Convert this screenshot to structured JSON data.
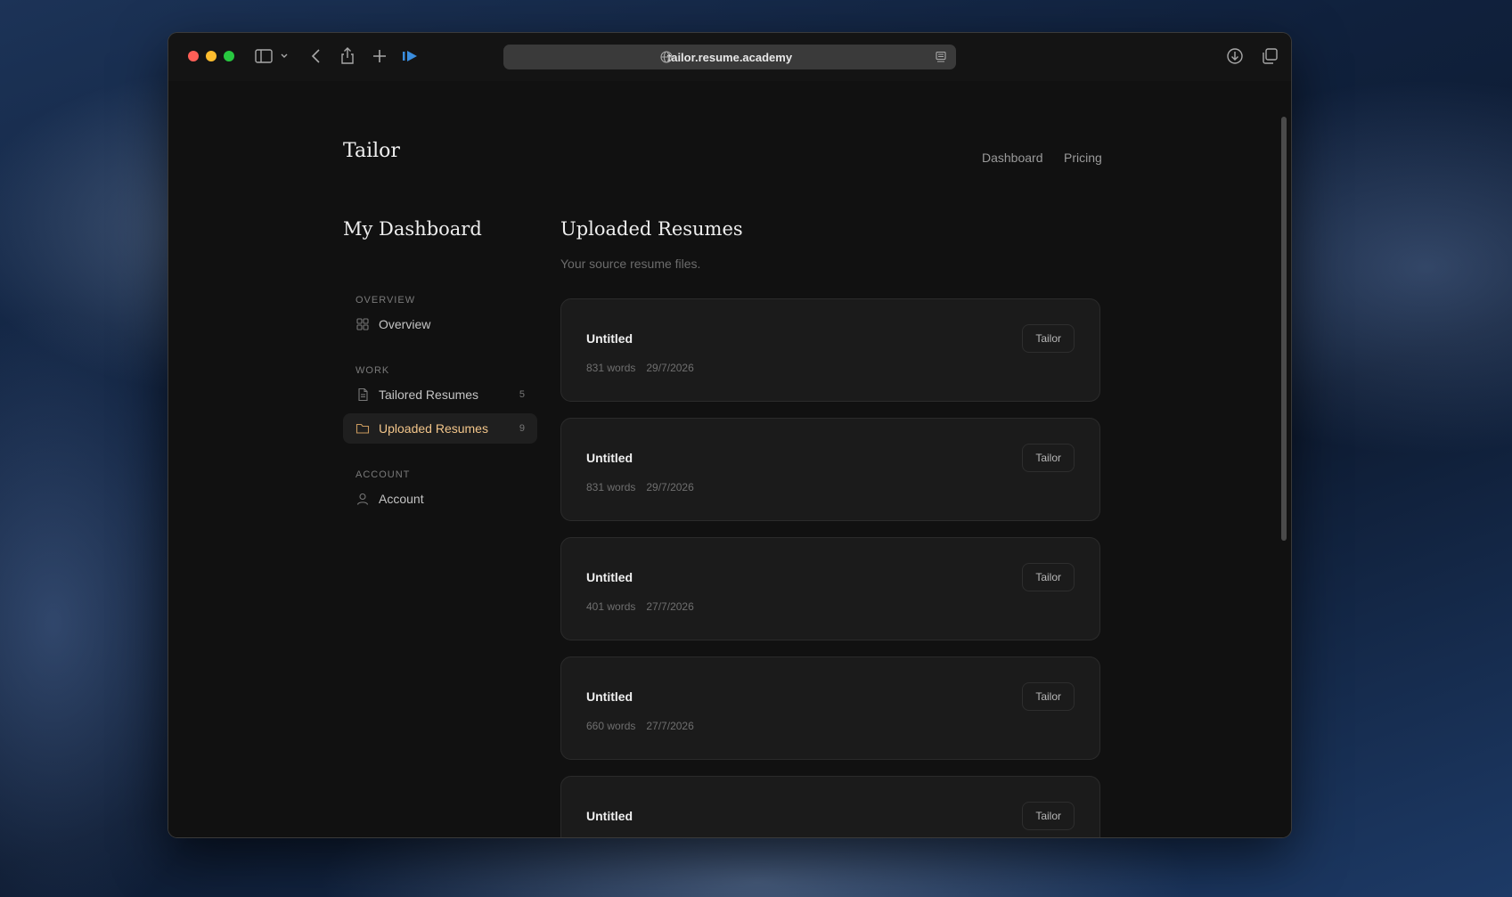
{
  "browser": {
    "url": "tailor.resume.academy",
    "traffic_lights": [
      "#ff5f57",
      "#febc2e",
      "#28c840"
    ],
    "toolbar_icons": [
      "sidebar-icon",
      "chevron-down-icon",
      "back-icon",
      "share-icon",
      "plus-icon",
      "extension-icon"
    ],
    "right_icons": [
      "download-icon",
      "tabs-overview-icon"
    ]
  },
  "header": {
    "logo": "Tailor",
    "nav": [
      "Dashboard",
      "Pricing"
    ]
  },
  "sidebar": {
    "title": "My Dashboard",
    "sections": [
      {
        "label": "OVERVIEW",
        "items": [
          {
            "label": "Overview",
            "icon": "grid-icon",
            "count": ""
          }
        ]
      },
      {
        "label": "WORK",
        "items": [
          {
            "label": "Tailored Resumes",
            "icon": "document-icon",
            "count": "5"
          },
          {
            "label": "Uploaded Resumes",
            "icon": "folder-icon",
            "count": "9",
            "active": true
          }
        ]
      },
      {
        "label": "ACCOUNT",
        "items": [
          {
            "label": "Account",
            "icon": "user-icon",
            "count": ""
          }
        ]
      }
    ]
  },
  "main": {
    "title": "Uploaded Resumes",
    "subtitle": "Your source resume files.",
    "button_label": "Tailor",
    "resumes": [
      {
        "name": "Untitled",
        "words": "831 words",
        "date": "29/7/2026"
      },
      {
        "name": "Untitled",
        "words": "831 words",
        "date": "29/7/2026"
      },
      {
        "name": "Untitled",
        "words": "401 words",
        "date": "27/7/2026"
      },
      {
        "name": "Untitled",
        "words": "660 words",
        "date": "27/7/2026"
      },
      {
        "name": "Untitled",
        "words": "",
        "date": ""
      }
    ]
  },
  "colors": {
    "accent": "#f2c58a",
    "background": "#111111",
    "card": "#1b1b1b"
  }
}
